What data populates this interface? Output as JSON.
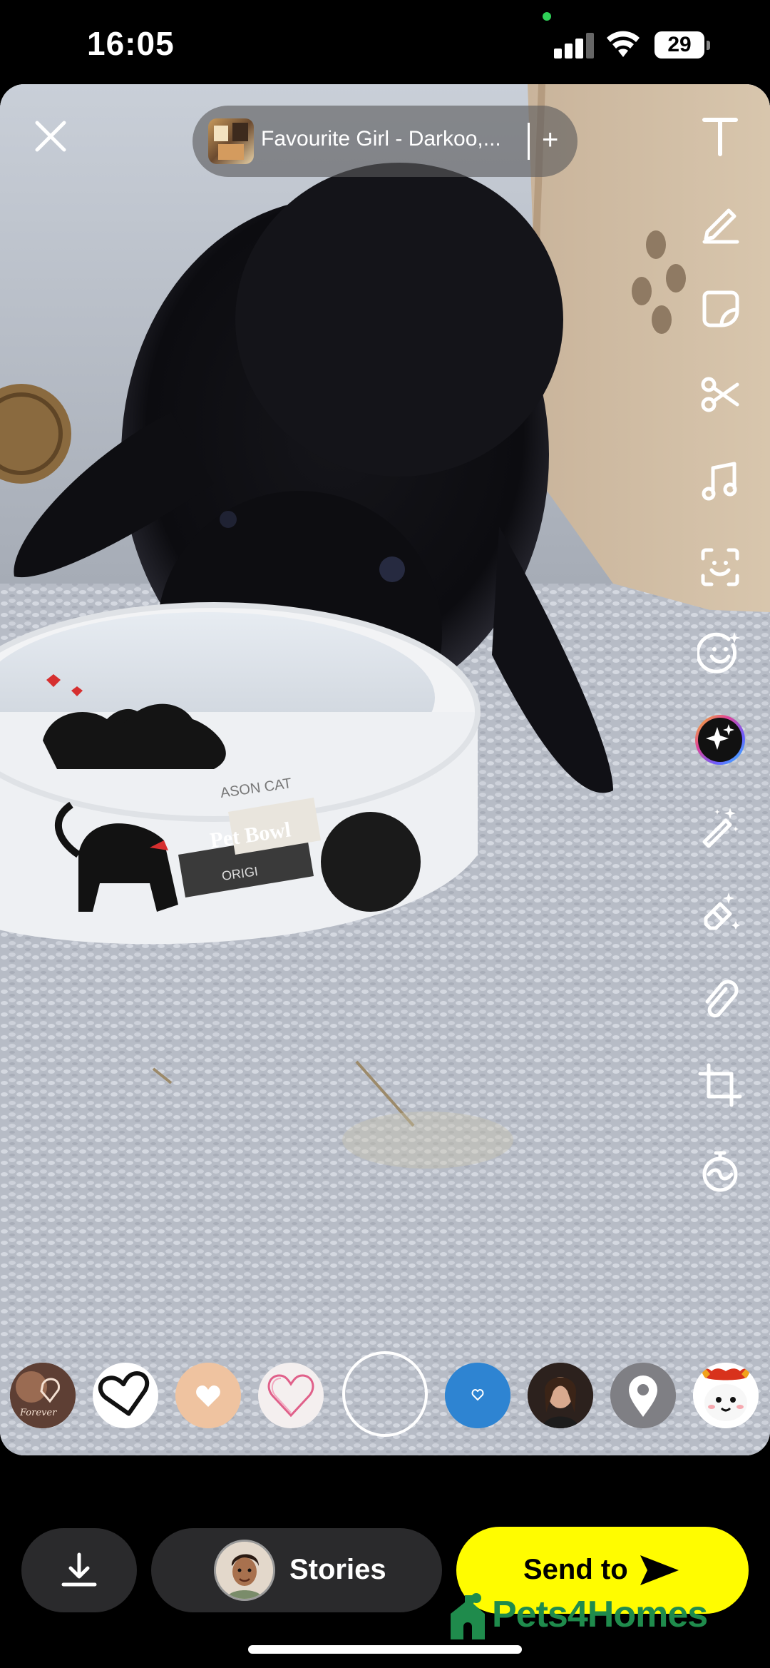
{
  "status_bar": {
    "time": "16:05",
    "battery_level": "29",
    "signal_bars": 3,
    "icons": [
      "cellular-signal-icon",
      "wifi-icon",
      "battery-icon"
    ]
  },
  "editor": {
    "close_icon": "close-icon",
    "music": {
      "title": "Favourite Girl - Darkoo,...",
      "add_label": "+"
    },
    "tools": [
      {
        "name": "text-tool",
        "icon": "text-icon"
      },
      {
        "name": "draw-tool",
        "icon": "pencil-icon"
      },
      {
        "name": "sticker-tool",
        "icon": "sticker-icon"
      },
      {
        "name": "scissors-tool",
        "icon": "scissors-icon"
      },
      {
        "name": "music-tool",
        "icon": "music-note-icon"
      },
      {
        "name": "scan-tool",
        "icon": "scan-icon"
      },
      {
        "name": "lens-tool",
        "icon": "smiley-sparkle-icon"
      },
      {
        "name": "ai-tool",
        "icon": "sparkle-icon"
      },
      {
        "name": "magic-wand-tool",
        "icon": "magic-wand-icon"
      },
      {
        "name": "eraser-tool",
        "icon": "magic-eraser-icon"
      },
      {
        "name": "attach-tool",
        "icon": "paperclip-icon"
      },
      {
        "name": "crop-tool",
        "icon": "crop-icon"
      },
      {
        "name": "timer-tool",
        "icon": "timer-icon"
      }
    ]
  },
  "photo": {
    "bowl_label": "Pet Bowl",
    "bowl_brand": "ASON CAT",
    "bowl_tag": "ORIGI"
  },
  "lenses": [
    {
      "name": "lens-photo-heart",
      "icon": "photo-heart-lens"
    },
    {
      "name": "lens-outline-heart",
      "icon": "outline-heart-icon"
    },
    {
      "name": "lens-peach-heart",
      "icon": "white-heart-icon"
    },
    {
      "name": "lens-pink-heart",
      "icon": "pink-heart-icon"
    },
    {
      "name": "lens-blue-heart",
      "icon": "small-heart-icon"
    },
    {
      "name": "lens-portrait",
      "icon": "portrait-lens"
    },
    {
      "name": "lens-location",
      "icon": "location-pin-icon"
    },
    {
      "name": "lens-devil",
      "icon": "devil-face-icon"
    }
  ],
  "actions": {
    "download_icon": "download-icon",
    "stories_label": "Stories",
    "send_label": "Send to"
  },
  "watermark": "Pets4Homes",
  "colors": {
    "send_button": "#fffc00",
    "pill_background": "#2a2a2c",
    "watermark": "#1f8b4c"
  }
}
